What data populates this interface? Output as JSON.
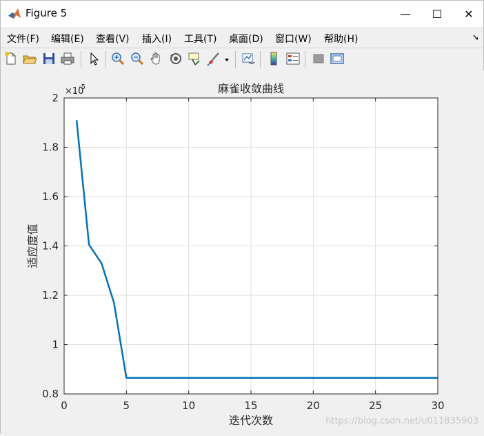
{
  "window": {
    "title": "Figure 5",
    "minimize_glyph": "—",
    "maximize_glyph": "☐",
    "close_glyph": "✕"
  },
  "menu": {
    "items": [
      "文件(F)",
      "编辑(E)",
      "查看(V)",
      "插入(I)",
      "工具(T)",
      "桌面(D)",
      "窗口(W)",
      "帮助(H)"
    ],
    "overflow_glyph": "➘"
  },
  "toolbar": {
    "icons": [
      "new-file-icon",
      "open-folder-icon",
      "save-icon",
      "print-icon",
      "pointer-icon",
      "zoom-in-icon",
      "zoom-out-icon",
      "pan-hand-icon",
      "rotate-3d-icon",
      "data-cursor-icon",
      "brush-icon",
      "link-plot-icon",
      "colorbar-icon",
      "legend-icon",
      "hide-plot-tools-icon",
      "show-plot-tools-icon"
    ]
  },
  "watermark": "https://blog.csdn.net/u011835903",
  "chart_data": {
    "type": "line",
    "title": "麻雀收敛曲线",
    "xlabel": "迭代次数",
    "ylabel": "适应度值",
    "exponent_label": "×10",
    "exponent_power": "-5",
    "xlim": [
      0,
      30
    ],
    "ylim": [
      0.8,
      2.0
    ],
    "y_multiplier": 1e-05,
    "xticks": [
      0,
      5,
      10,
      15,
      20,
      25,
      30
    ],
    "yticks": [
      0.8,
      1,
      1.2,
      1.4,
      1.6,
      1.8,
      2
    ],
    "xtick_labels": [
      "0",
      "5",
      "10",
      "15",
      "20",
      "25",
      "30"
    ],
    "ytick_labels": [
      "0.8",
      "1",
      "1.2",
      "1.4",
      "1.6",
      "1.8",
      "2"
    ],
    "grid": true,
    "series": [
      {
        "color": "#0072bd",
        "x": [
          1,
          2,
          3,
          4,
          5,
          6,
          7,
          8,
          9,
          10,
          11,
          12,
          13,
          14,
          15,
          16,
          17,
          18,
          19,
          20,
          21,
          22,
          23,
          24,
          25,
          26,
          27,
          28,
          29,
          30
        ],
        "y": [
          1.91,
          1.405,
          1.33,
          1.17,
          0.865,
          0.865,
          0.865,
          0.865,
          0.865,
          0.865,
          0.865,
          0.865,
          0.865,
          0.865,
          0.865,
          0.865,
          0.865,
          0.865,
          0.865,
          0.865,
          0.865,
          0.865,
          0.865,
          0.865,
          0.865,
          0.865,
          0.865,
          0.865,
          0.865,
          0.865
        ]
      }
    ]
  }
}
